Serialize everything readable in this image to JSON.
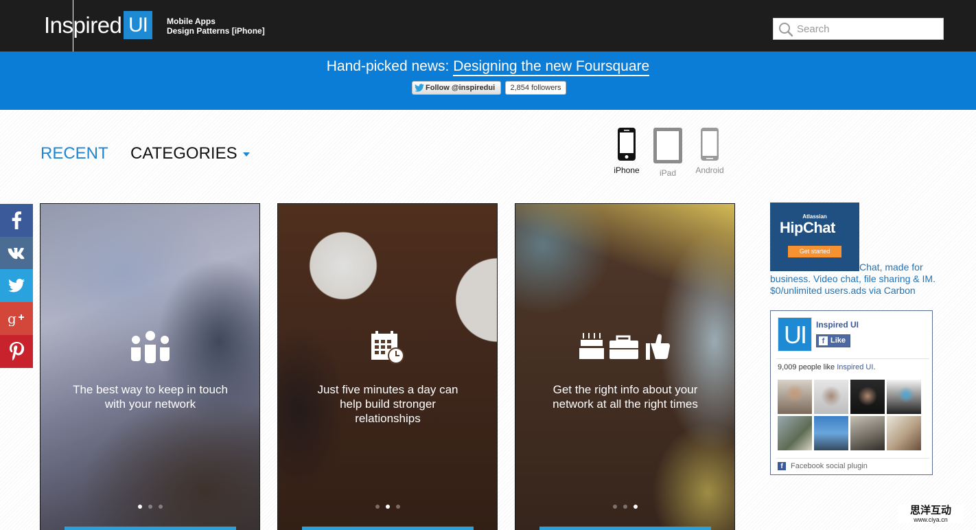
{
  "header": {
    "logo_text": "Inspired",
    "logo_box": "UI",
    "tagline_line1": "Mobile Apps",
    "tagline_line2": "Design Patterns [iPhone]",
    "search_placeholder": "Search"
  },
  "news": {
    "prefix": "Hand-picked news: ",
    "link_text": "Designing the new Foursquare",
    "follow_label": "Follow @inspiredui",
    "followers": "2,854 followers"
  },
  "nav": {
    "recent": "RECENT",
    "categories": "CATEGORIES"
  },
  "devices": [
    {
      "label": "iPhone",
      "active": true
    },
    {
      "label": "iPad",
      "active": false
    },
    {
      "label": "Android",
      "active": false
    }
  ],
  "social": [
    "facebook-icon",
    "vk-icon",
    "twitter-icon",
    "google-plus-icon",
    "pinterest-icon"
  ],
  "cards": [
    {
      "text": "The best way to keep in touch with your network",
      "icon": "people-icon",
      "active_dot": 0
    },
    {
      "text": "Just five minutes a day can help build stronger relationships",
      "icon": "calendar-clock-icon",
      "active_dot": 1
    },
    {
      "text": "Get the right info about your network at all the right times",
      "icon": "cake-briefcase-thumbsup-icon",
      "active_dot": 2
    }
  ],
  "ad": {
    "atlassian": "Atlassian",
    "product": "HipChat",
    "button": "Get started",
    "text_line1": "Chat, made for",
    "text_line2": "business. Video chat, file sharing & IM.",
    "text_line3": "$0/unlimited users.ads via Carbon"
  },
  "facebook": {
    "logo": "UI",
    "page_name": "Inspired UI",
    "like_label": "Like",
    "count_text": "9,009 people like ",
    "count_link": "Inspired UI",
    "count_suffix": ".",
    "plugin_label": "Facebook social plugin"
  },
  "watermark": {
    "line1": "思洋互动",
    "line2": "www.ciya.cn"
  },
  "colors": {
    "topbar": "#1d1d1d",
    "newsbar": "#0b7dd6",
    "accent": "#1f86cf",
    "facebook": "#3b5a9a"
  }
}
